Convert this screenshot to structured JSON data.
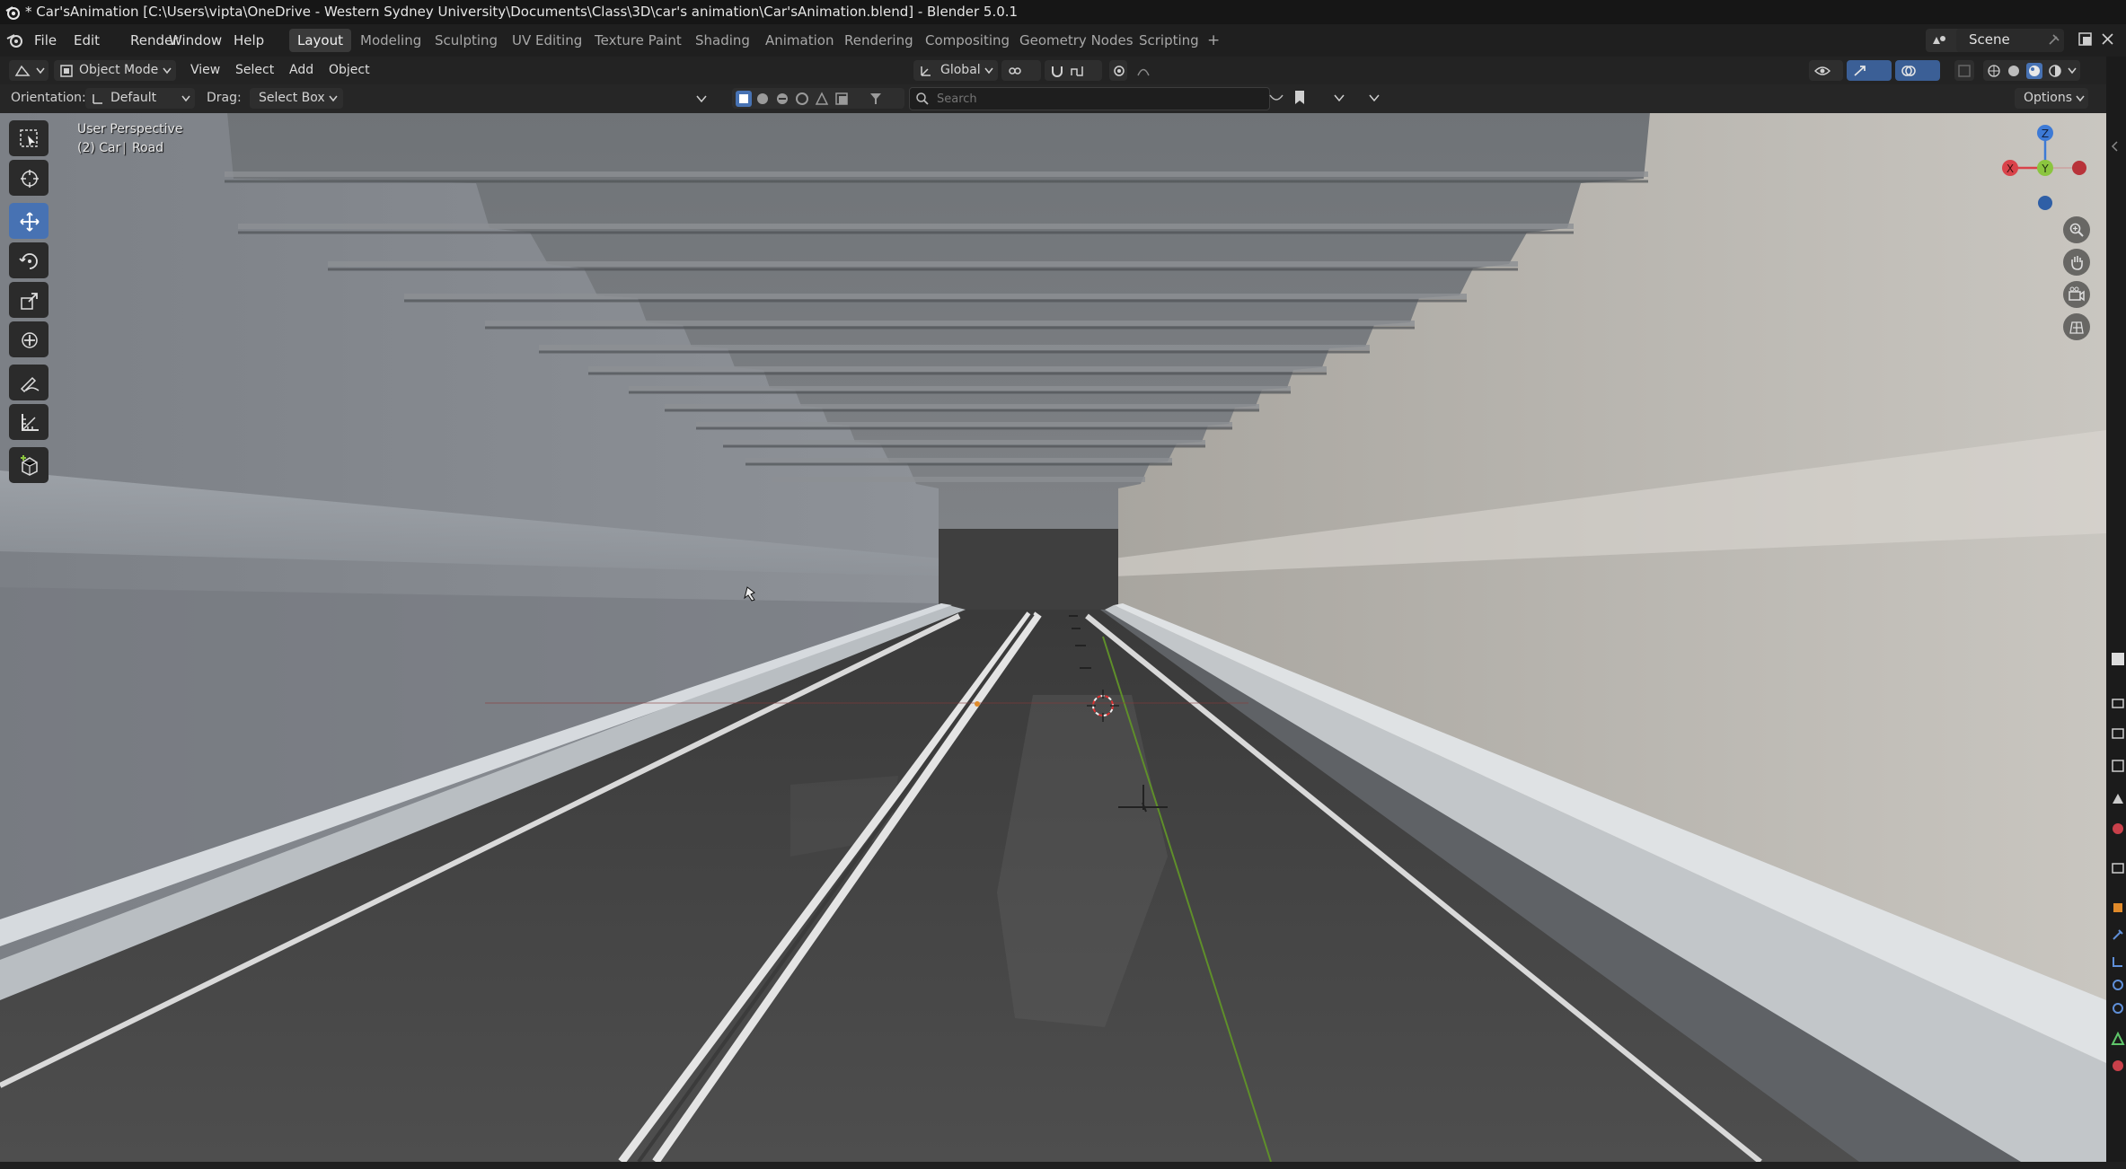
{
  "window": {
    "title": "* Car'sAnimation [C:\\Users\\vipta\\OneDrive - Western Sydney University\\Documents\\Class\\3D\\car's animation\\Car'sAnimation.blend] - Blender 5.0.1"
  },
  "menu": {
    "items": [
      "File",
      "Edit",
      "Render",
      "Window",
      "Help"
    ]
  },
  "workspaces": {
    "tabs": [
      "Layout",
      "Modeling",
      "Sculpting",
      "UV Editing",
      "Texture Paint",
      "Shading",
      "Animation",
      "Rendering",
      "Compositing",
      "Geometry Nodes",
      "Scripting"
    ],
    "active": "Layout",
    "add_label": "+"
  },
  "scene": {
    "name": "Scene"
  },
  "viewport_header": {
    "mode": "Object Mode",
    "menus": [
      "View",
      "Select",
      "Add",
      "Object"
    ],
    "transform_orientation": "Global"
  },
  "tool_settings": {
    "orientation_label": "Orientation:",
    "orientation_value": "Default",
    "drag_label": "Drag:",
    "drag_value": "Select Box",
    "search_placeholder": "Search",
    "options_label": "Options"
  },
  "overlay_text": {
    "view_name": "User Perspective",
    "collection_info": "(2) Car",
    "object_name": "Road"
  },
  "gizmo": {
    "x_label": "X",
    "y_label": "Y",
    "z_label": "Z"
  },
  "colors": {
    "accent": "#4772b3",
    "axis_x": "#d9434a",
    "axis_y": "#8bc53f",
    "axis_z": "#3d7ad6"
  },
  "icons": {
    "toolbar": [
      "select-box-icon",
      "cursor-icon",
      "move-icon",
      "rotate-icon",
      "scale-icon",
      "transform-icon",
      "annotate-icon",
      "measure-icon",
      "add-cube-icon"
    ],
    "nav": [
      "zoom-icon",
      "pan-hand-icon",
      "camera-icon",
      "grid-ortho-icon"
    ]
  }
}
